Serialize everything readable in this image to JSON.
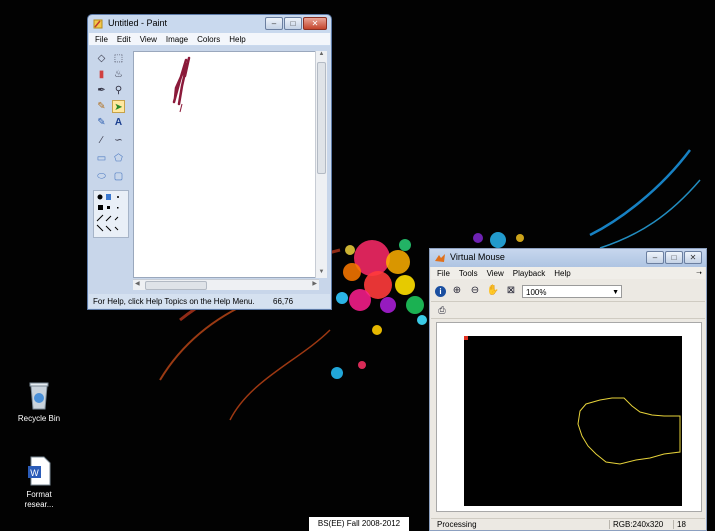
{
  "desktop": {
    "icons": [
      {
        "label": "Recycle Bin",
        "icon": "recycle-bin-icon"
      },
      {
        "label": "Format resear...",
        "icon": "word-document-icon"
      }
    ],
    "taskbar_label": "BS(EE) Fall 2008-2012"
  },
  "paint": {
    "title": "Untitled - Paint",
    "menu": [
      "File",
      "Edit",
      "View",
      "Image",
      "Colors",
      "Help"
    ],
    "status_text": "For Help, click Help Topics on the Help Menu.",
    "coords": "66,76",
    "stroke_color": "#8b1a3a"
  },
  "vmouse": {
    "title": "Virtual Mouse",
    "menu": [
      "File",
      "Tools",
      "View",
      "Playback",
      "Help"
    ],
    "zoom_value": "100%",
    "status_text": "Processing",
    "image_info": "RGB:240x320",
    "frame_value": "18",
    "contour_color": "#e6d23a"
  }
}
